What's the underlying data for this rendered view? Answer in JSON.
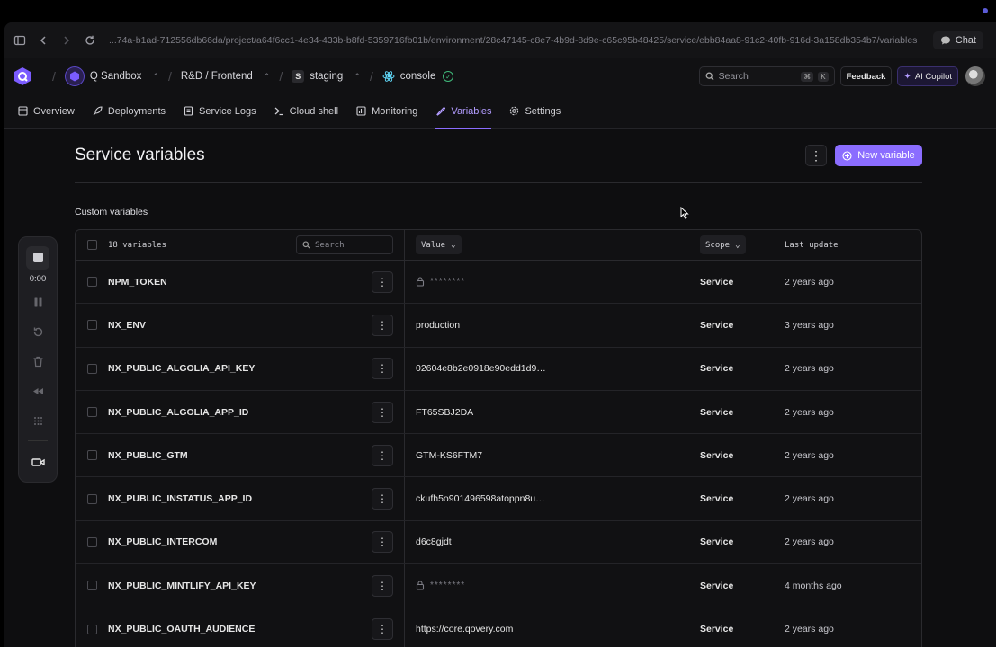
{
  "browser": {
    "url": "...74a-b1ad-712556db66da/project/a64f6cc1-4e34-433b-b8fd-5359716fb01b/environment/28c47145-c8e7-4b9d-8d9e-c65c95b48425/service/ebb84aa8-91c2-40fb-916d-3a158db354b7/variables",
    "chat_label": "Chat"
  },
  "header": {
    "org": "Q Sandbox",
    "project": "R&D / Frontend",
    "env_badge": "S",
    "environment": "staging",
    "service": "console",
    "search_placeholder": "Search",
    "kbd_cmd": "⌘",
    "kbd_k": "K",
    "feedback_label": "Feedback",
    "copilot_label": "AI Copilot"
  },
  "tabs": [
    {
      "label": "Overview",
      "icon": "layout-icon"
    },
    {
      "label": "Deployments",
      "icon": "rocket-icon"
    },
    {
      "label": "Service Logs",
      "icon": "logs-icon"
    },
    {
      "label": "Cloud shell",
      "icon": "terminal-icon"
    },
    {
      "label": "Monitoring",
      "icon": "chart-icon"
    },
    {
      "label": "Variables",
      "icon": "wrench-icon",
      "active": true
    },
    {
      "label": "Settings",
      "icon": "gear-icon"
    }
  ],
  "main": {
    "title": "Service variables",
    "new_variable_label": "New variable",
    "section_label": "Custom variables",
    "table": {
      "count_label": "18 variables",
      "search_placeholder": "Search",
      "value_header": "Value",
      "scope_header": "Scope",
      "update_header": "Last update",
      "rows": [
        {
          "name": "NPM_TOKEN",
          "value": "********",
          "secret": true,
          "scope": "Service",
          "updated": "2 years ago"
        },
        {
          "name": "NX_ENV",
          "value": "production",
          "secret": false,
          "scope": "Service",
          "updated": "3 years ago"
        },
        {
          "name": "NX_PUBLIC_ALGOLIA_API_KEY",
          "value": "02604e8b2e0918e90edd1d9…",
          "secret": false,
          "scope": "Service",
          "updated": "2 years ago"
        },
        {
          "name": "NX_PUBLIC_ALGOLIA_APP_ID",
          "value": "FT65SBJ2DA",
          "secret": false,
          "scope": "Service",
          "updated": "2 years ago"
        },
        {
          "name": "NX_PUBLIC_GTM",
          "value": "GTM-KS6FTM7",
          "secret": false,
          "scope": "Service",
          "updated": "2 years ago"
        },
        {
          "name": "NX_PUBLIC_INSTATUS_APP_ID",
          "value": "ckufh5o901496598atoppn8u…",
          "secret": false,
          "scope": "Service",
          "updated": "2 years ago"
        },
        {
          "name": "NX_PUBLIC_INTERCOM",
          "value": "d6c8gjdt",
          "secret": false,
          "scope": "Service",
          "updated": "2 years ago"
        },
        {
          "name": "NX_PUBLIC_MINTLIFY_API_KEY",
          "value": "********",
          "secret": true,
          "scope": "Service",
          "updated": "4 months ago"
        },
        {
          "name": "NX_PUBLIC_OAUTH_AUDIENCE",
          "value": "https://core.qovery.com",
          "secret": false,
          "scope": "Service",
          "updated": "2 years ago"
        }
      ]
    }
  },
  "recorder": {
    "time": "0:00"
  },
  "colors": {
    "accent": "#8b6dff",
    "success": "#3fb97a"
  }
}
